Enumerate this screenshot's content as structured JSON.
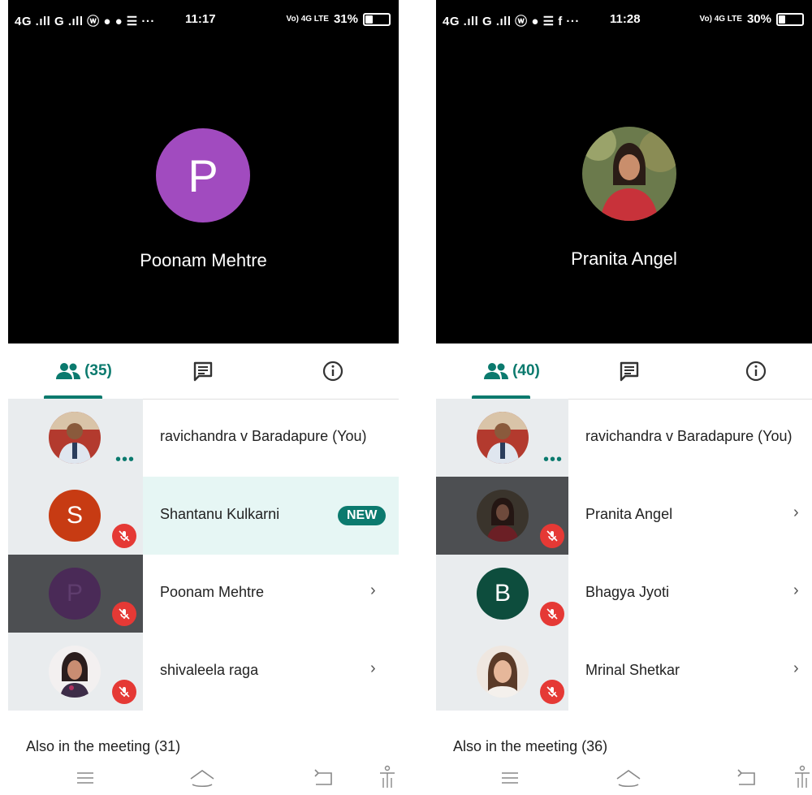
{
  "left": {
    "status": {
      "signal": "4G .ıll G .ıll ⓦ ● ● ☰ ···",
      "time": "11:17",
      "network": "Vo) 4G LTE",
      "battery": "31%",
      "battery_level": 0.31
    },
    "stage": {
      "avatar_letter": "P",
      "name": "Poonam Mehtre",
      "avatar_color": "#a14bbf"
    },
    "tabs": {
      "people_count": "(35)"
    },
    "participants": [
      {
        "name": "ravichandra v Baradapure (You)",
        "kind": "photo",
        "state": "speaking"
      },
      {
        "name": "Shantanu Kulkarni",
        "letter": "S",
        "color": "#c73b13",
        "badge": "NEW",
        "muted": true
      },
      {
        "name": "Poonam Mehtre",
        "letter": "P",
        "color": "#4a2a57",
        "muted": true
      },
      {
        "name": "shivaleela raga",
        "kind": "photo",
        "muted": true
      }
    ],
    "also": "Also in the meeting (31)"
  },
  "right": {
    "status": {
      "signal": "4G .ıll G .ıll ⓦ ● ☰ f ···",
      "time": "11:28",
      "network": "Vo) 4G LTE",
      "battery": "30%",
      "battery_level": 0.3
    },
    "stage": {
      "name": "Pranita Angel"
    },
    "tabs": {
      "people_count": "(40)"
    },
    "participants": [
      {
        "name": "ravichandra v Baradapure (You)",
        "kind": "photo",
        "state": "speaking"
      },
      {
        "name": "Pranita Angel",
        "kind": "photo",
        "muted": true
      },
      {
        "name": "Bhagya Jyoti",
        "letter": "B",
        "color": "#0d4d3d",
        "muted": true
      },
      {
        "name": "Mrinal Shetkar",
        "kind": "photo",
        "muted": true
      }
    ],
    "also": "Also in the meeting (36)"
  },
  "colors": {
    "accent": "#0b7a6e",
    "mute": "#e53935"
  },
  "icons": [
    "people-icon",
    "chat-icon",
    "info-icon",
    "mic-off-icon",
    "chevron-right-icon",
    "menu-icon",
    "home-icon",
    "back-icon",
    "accessibility-icon"
  ]
}
